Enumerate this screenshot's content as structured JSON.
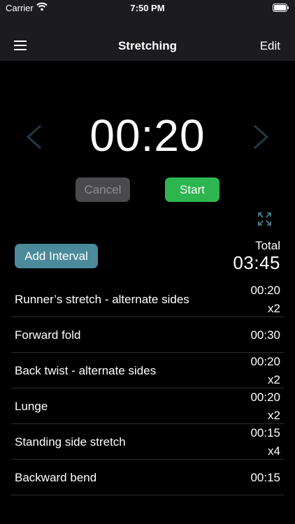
{
  "status_bar": {
    "carrier": "Carrier",
    "time": "7:50 PM",
    "icons": [
      "wifi-icon",
      "battery-icon"
    ]
  },
  "nav": {
    "title": "Stretching",
    "edit_label": "Edit",
    "menu_icon": "hamburger-menu-icon"
  },
  "timer": {
    "display": "00:20",
    "prev_icon": "chevron-left-icon",
    "next_icon": "chevron-right-icon"
  },
  "controls": {
    "cancel_label": "Cancel",
    "start_label": "Start",
    "expand_icon": "expand-icon"
  },
  "summary": {
    "add_interval_label": "Add Interval",
    "total_label": "Total",
    "total_value": "03:45"
  },
  "intervals": [
    {
      "name": "Runner’s stretch - alternate sides",
      "duration": "00:20",
      "reps": "x2"
    },
    {
      "name": "Forward fold",
      "duration": "00:30",
      "reps": ""
    },
    {
      "name": "Back twist - alternate sides",
      "duration": "00:20",
      "reps": "x2"
    },
    {
      "name": "Lunge",
      "duration": "00:20",
      "reps": "x2"
    },
    {
      "name": "Standing side stretch",
      "duration": "00:15",
      "reps": "x4"
    },
    {
      "name": "Backward bend",
      "duration": "00:15",
      "reps": ""
    }
  ],
  "colors": {
    "background": "#000000",
    "bar": "#1c1c1e",
    "start": "#2db54f",
    "add_interval": "#4b8a9a",
    "cancel": "#4a4a4c",
    "chevron": "#1f3a44",
    "expand_icon": "#4b8a9a"
  }
}
